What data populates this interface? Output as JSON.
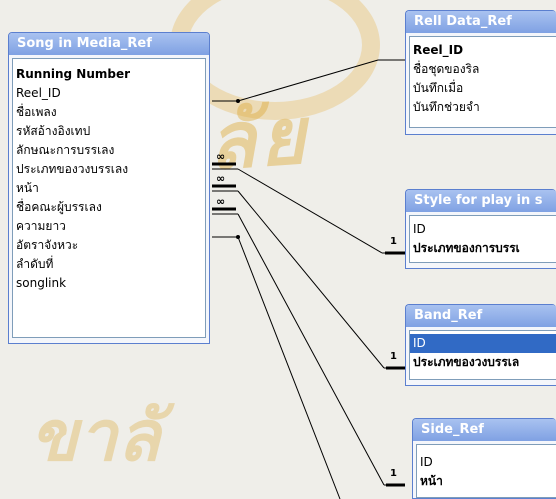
{
  "watermark": {
    "text": "ยาลัย",
    "text2": "ขาลั"
  },
  "tables": {
    "song": {
      "title": "Song in Media_Ref",
      "fields": [
        "Running Number",
        "Reel_ID",
        "ชื่อเพลง",
        "รหัสอ้างอิงเทป",
        "ลักษณะการบรรเลง",
        "ประเภทของวงบรรเลง",
        "หน้า",
        "ชื่อคณะผู้บรรเลง",
        "ความยาว",
        "อัตราจังหวะ",
        "ลำดับที่",
        "songlink"
      ]
    },
    "reel": {
      "title": "Rell Data_Ref",
      "fields": [
        "Reel_ID",
        "ชื่อชุดของริล",
        "บันทึกเมื่อ",
        "บันทึกช่วยจำ"
      ]
    },
    "style": {
      "title": "Style for play in s",
      "fields": [
        "ID",
        "ประเภทของการบรรเ"
      ]
    },
    "band": {
      "title": "Band_Ref",
      "fields": [
        "ID",
        "ประเภทของวงบรรเล"
      ]
    },
    "side": {
      "title": "Side_Ref",
      "fields": [
        "ID",
        "หน้า"
      ]
    }
  },
  "relations": {
    "one": "1",
    "many": "∞"
  }
}
